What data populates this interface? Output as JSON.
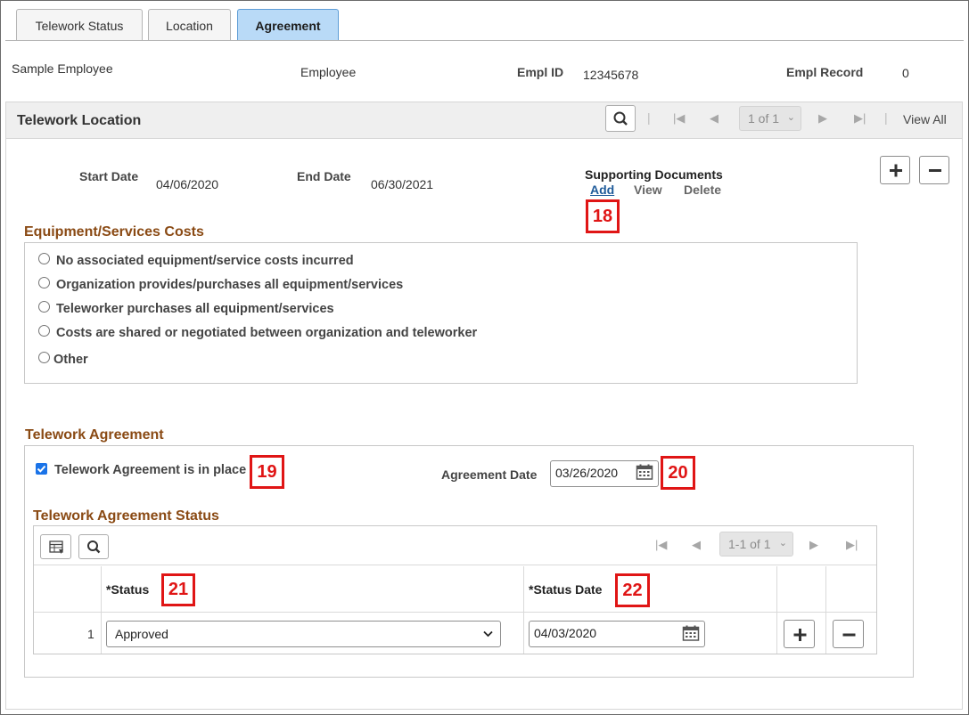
{
  "tabs": [
    {
      "label": "Telework Status",
      "active": false
    },
    {
      "label": "Location",
      "active": false
    },
    {
      "label": "Agreement",
      "active": true
    }
  ],
  "employee": {
    "name": "Sample Employee",
    "type": "Employee",
    "empl_id_label": "Empl ID",
    "empl_id": "12345678",
    "empl_record_label": "Empl Record",
    "empl_record": "0"
  },
  "location_section": {
    "title": "Telework Location",
    "pager": "1 of 1",
    "view_all": "View All",
    "start_date_label": "Start Date",
    "start_date": "04/06/2020",
    "end_date_label": "End Date",
    "end_date": "06/30/2021",
    "supporting_documents": {
      "title": "Supporting Documents",
      "add": "Add",
      "view": "View",
      "delete": "Delete"
    }
  },
  "equipment": {
    "title": "Equipment/Services Costs",
    "options": [
      "No associated equipment/service costs incurred",
      "Organization provides/purchases all equipment/services",
      "Teleworker purchases all equipment/services",
      "Costs are shared or negotiated between organization and teleworker",
      "Other"
    ]
  },
  "agreement": {
    "title": "Telework Agreement",
    "in_place_label": "Telework Agreement is in place",
    "in_place_checked": true,
    "date_label": "Agreement Date",
    "date": "03/26/2020"
  },
  "status_grid": {
    "title": "Telework Agreement Status",
    "pager": "1-1 of 1",
    "col_status": "*Status",
    "col_status_date": "*Status Date",
    "rows": [
      {
        "num": "1",
        "status": "Approved",
        "status_date": "04/03/2020"
      }
    ]
  },
  "callouts": [
    "18",
    "19",
    "20",
    "21",
    "22"
  ],
  "colors": {
    "accent_tab": "#b9daf7",
    "section_title": "#8a4a14",
    "callout": "#e01515",
    "link": "#1f5b9a"
  }
}
